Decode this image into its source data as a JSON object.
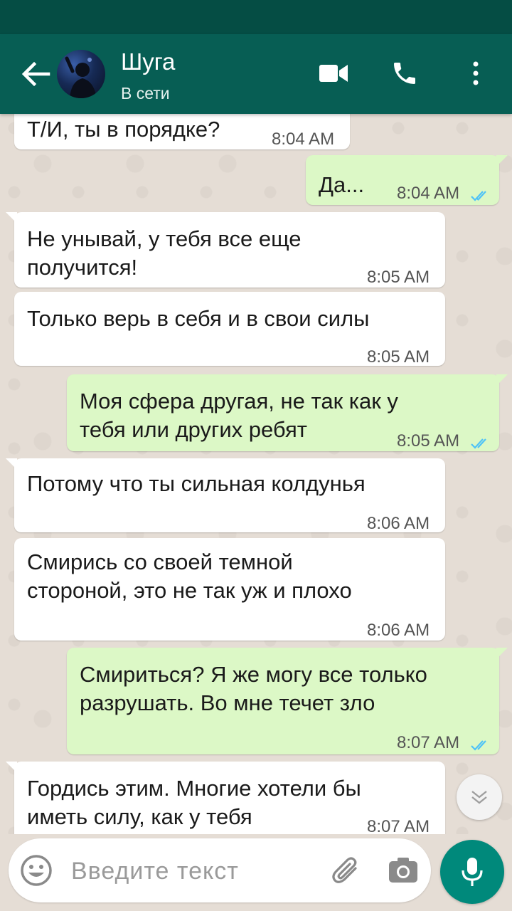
{
  "header": {
    "contact_name": "Шуга",
    "contact_status": "В сети",
    "icons": [
      "back-arrow-icon",
      "video-call-icon",
      "voice-call-icon",
      "more-options-icon"
    ]
  },
  "colors": {
    "header_bg": "#075e54",
    "statusbar_bg": "#054d44",
    "chat_bg": "#e5ddd5",
    "incoming_bubble": "#ffffff",
    "outgoing_bubble": "#dcf8c6",
    "read_ticks": "#4fc3f7",
    "mic_button": "#00897b"
  },
  "messages": [
    {
      "direction": "in",
      "lines": [
        "Т/И, ты в порядке?"
      ],
      "time": "8:04 AM"
    },
    {
      "direction": "out",
      "lines": [
        "Да..."
      ],
      "time": "8:04 AM",
      "status": "read"
    },
    {
      "direction": "in",
      "lines": [
        "Не унывай, у тебя все еще",
        "получится!"
      ],
      "time": "8:05 AM"
    },
    {
      "direction": "in",
      "lines": [
        "Только верь в себя и в свои силы"
      ],
      "time": "8:05 AM"
    },
    {
      "direction": "out",
      "lines": [
        "Моя сфера другая, не так как у",
        "тебя или других ребят"
      ],
      "time": "8:05 AM",
      "status": "read"
    },
    {
      "direction": "in",
      "lines": [
        "Потому что ты сильная колдунья"
      ],
      "time": "8:06 AM"
    },
    {
      "direction": "in",
      "lines": [
        "Смирись со своей темной",
        "стороной, это не так уж и плохо"
      ],
      "time": "8:06 AM"
    },
    {
      "direction": "out",
      "lines": [
        "Смириться? Я же могу все только",
        "разрушать. Во мне течет зло"
      ],
      "time": "8:07 AM",
      "status": "read"
    },
    {
      "direction": "in",
      "lines": [
        "Гордись этим. Многие хотели бы",
        "иметь силу, как у тебя"
      ],
      "time": "8:07 AM"
    }
  ],
  "composer": {
    "placeholder": "Введите текст",
    "icons": [
      "emoji-icon",
      "attach-icon",
      "camera-icon",
      "mic-icon"
    ]
  },
  "scroll_down_icon": "chevron-double-down-icon"
}
